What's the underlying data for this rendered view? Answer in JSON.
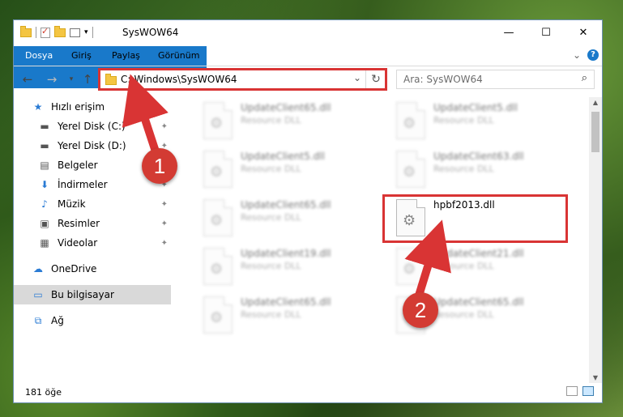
{
  "window": {
    "title": "SysWOW64",
    "controls": {
      "minimize": "—",
      "maximize": "☐",
      "close": "✕"
    }
  },
  "ribbon": {
    "tabs": [
      "Dosya",
      "Giriş",
      "Paylaş",
      "Görünüm"
    ],
    "expand_glyph": "⌄",
    "help_label": "?"
  },
  "navbar": {
    "back": "←",
    "forward": "→",
    "recent": "▾",
    "up": "↑",
    "address_path": "C:\\Windows\\SysWOW64",
    "address_dropdown": "⌄",
    "refresh": "↻",
    "search_placeholder": "Ara: SysWOW64",
    "search_icon": "⌕"
  },
  "nav_pane": {
    "items": [
      {
        "label": "Hızlı erişim",
        "icon": "star-icon",
        "glyph": "★",
        "pinned": false
      },
      {
        "label": "Yerel Disk (C:)",
        "icon": "drive-icon",
        "glyph": "▬",
        "pinned": true
      },
      {
        "label": "Yerel Disk (D:)",
        "icon": "drive-icon",
        "glyph": "▬",
        "pinned": true
      },
      {
        "label": "Belgeler",
        "icon": "documents-icon",
        "glyph": "▤",
        "pinned": true
      },
      {
        "label": "İndirmeler",
        "icon": "downloads-icon",
        "glyph": "⬇",
        "pinned": true
      },
      {
        "label": "Müzik",
        "icon": "music-icon",
        "glyph": "♪",
        "pinned": true
      },
      {
        "label": "Resimler",
        "icon": "pictures-icon",
        "glyph": "▣",
        "pinned": true
      },
      {
        "label": "Videolar",
        "icon": "videos-icon",
        "glyph": "▦",
        "pinned": true
      },
      {
        "label": "OneDrive",
        "icon": "cloud-icon",
        "glyph": "☁",
        "pinned": false
      },
      {
        "label": "Bu bilgisayar",
        "icon": "computer-icon",
        "glyph": "▭",
        "pinned": false
      },
      {
        "label": "Ağ",
        "icon": "network-icon",
        "glyph": "⧉",
        "pinned": false
      }
    ],
    "pin_glyph": "📌"
  },
  "files": [
    {
      "name": "UpdateClient65.dll",
      "type": "Resource DLL",
      "highlight": false
    },
    {
      "name": "UpdateClient5.dll",
      "type": "Resource DLL",
      "highlight": false
    },
    {
      "name": "UpdateClient5.dll",
      "type": "Resource DLL",
      "highlight": false
    },
    {
      "name": "UpdateClient63.dll",
      "type": "Resource DLL",
      "highlight": false
    },
    {
      "name": "UpdateClient65.dll",
      "type": "Resource DLL",
      "highlight": false
    },
    {
      "name": "hpbf2013.dll",
      "type": "",
      "highlight": true
    },
    {
      "name": "UpdateClient19.dll",
      "type": "Resource DLL",
      "highlight": false
    },
    {
      "name": "UpdateClient21.dll",
      "type": "Resource DLL",
      "highlight": false
    },
    {
      "name": "UpdateClient65.dll",
      "type": "Resource DLL",
      "highlight": false
    },
    {
      "name": "UpdateClient65.dll",
      "type": "Resource DLL",
      "highlight": false
    }
  ],
  "status": {
    "item_count": "181 öğe"
  },
  "annotations": {
    "step1": "1",
    "step2": "2",
    "color": "#d93434"
  }
}
